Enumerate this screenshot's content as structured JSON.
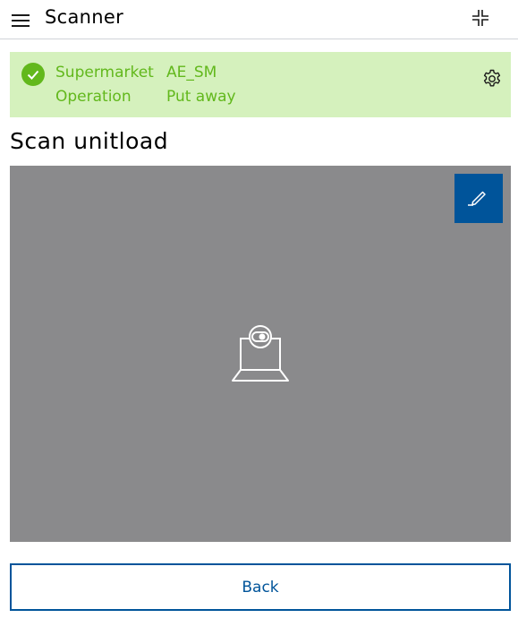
{
  "header": {
    "title": "Scanner",
    "menu_icon": "hamburger-menu-icon",
    "collapse_icon": "collapse-icon"
  },
  "status": {
    "state": "success",
    "check_icon": "check-circle-icon",
    "settings_icon": "gear-icon",
    "rows": [
      {
        "label": "Supermarket",
        "value": "AE_SM"
      },
      {
        "label": "Operation",
        "value": "Put away"
      }
    ],
    "colors": {
      "background": "#d5f1bd",
      "text": "#62b81c"
    }
  },
  "scan": {
    "title": "Scan unitload",
    "camera_icon": "scanner-camera-icon",
    "edit_icon": "pencil-icon"
  },
  "footer": {
    "back_label": "Back"
  },
  "colors": {
    "primary": "#00549a",
    "scan_area": "#8a8a8c"
  }
}
